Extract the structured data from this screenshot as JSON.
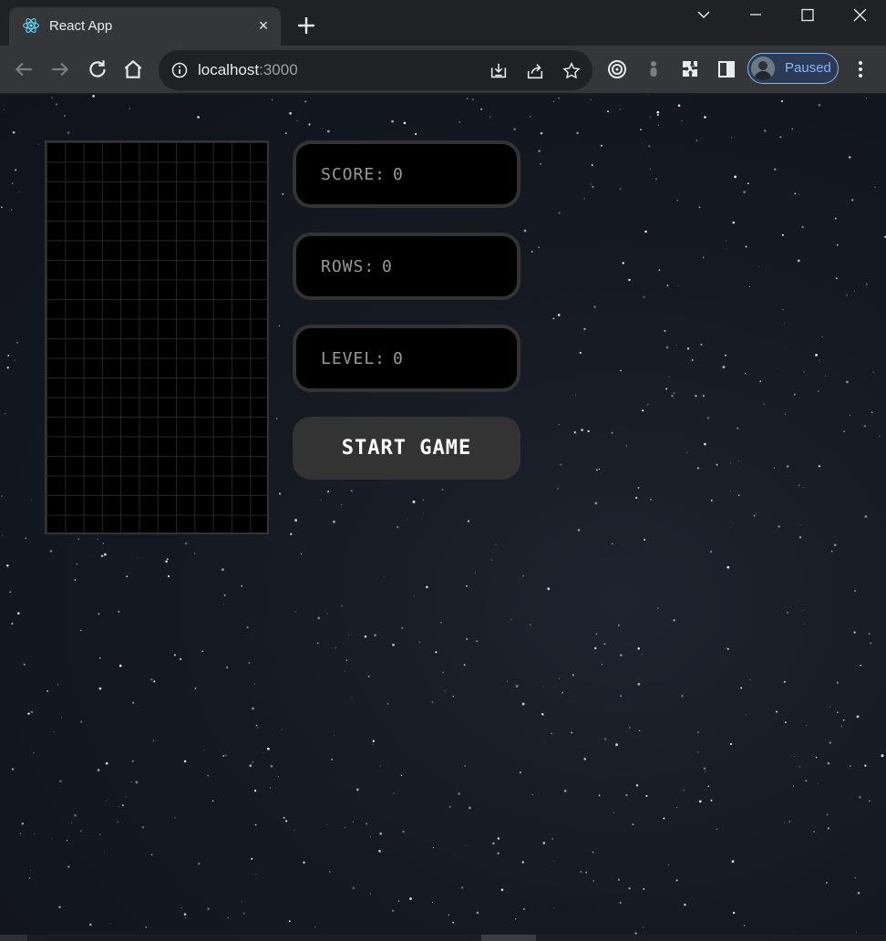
{
  "browser": {
    "tab_title": "React App",
    "tab_close": "×",
    "url_host": "localhost",
    "url_port": ":3000",
    "profile_label": "Paused",
    "accent": "#8ab4f8"
  },
  "game": {
    "score_label": "SCORE:",
    "score_value": "0",
    "rows_label": "ROWS:",
    "rows_value": "0",
    "level_label": "LEVEL:",
    "level_value": "0",
    "start_label": "START GAME",
    "stage_columns": 12,
    "stage_rows": 20
  }
}
